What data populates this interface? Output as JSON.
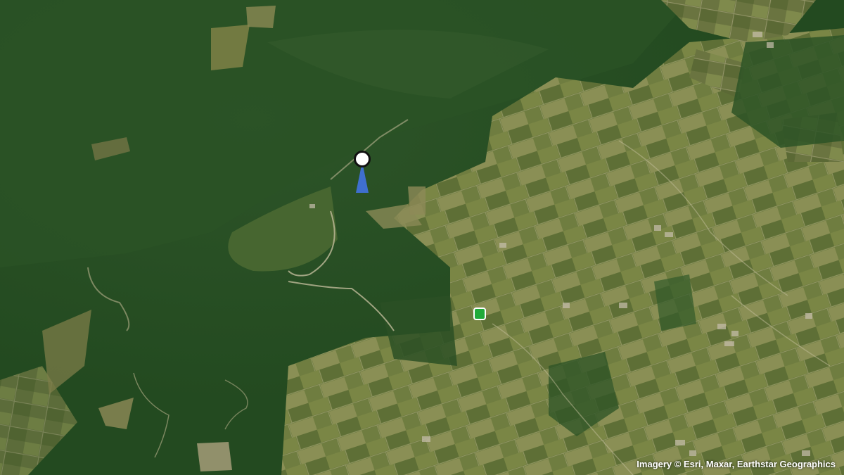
{
  "map": {
    "imagery": "satellite",
    "attribution": "Imagery © Esri, Maxar, Earthstar Geographics",
    "markers": [
      {
        "type": "current-position",
        "icon": "location-heading-icon",
        "color": "#3f6fcf"
      },
      {
        "type": "target",
        "icon": "green-square-icon",
        "color": "#1faa3a"
      }
    ]
  }
}
